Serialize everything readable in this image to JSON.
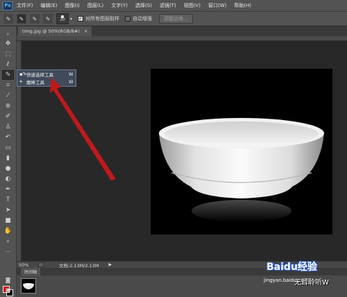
{
  "app": {
    "logo": "Ps"
  },
  "menu": [
    "文件(F)",
    "编辑(E)",
    "图像(I)",
    "图层(L)",
    "文字(Y)",
    "选择(S)",
    "滤镜(T)",
    "视图(V)",
    "窗口(W)",
    "帮助(H)"
  ],
  "options": {
    "brush_size": "30",
    "sample_all_label": "对所有图层取样",
    "auto_enhance_label": "自动增强",
    "refine_edge_label": "调整边缘..."
  },
  "document": {
    "tab_title": "timg.jpg @ 50%(RGB/8#)",
    "tab_close": "×"
  },
  "flyout": {
    "items": [
      {
        "label": "快速选择工具",
        "key": "W"
      },
      {
        "label": "魔棒工具",
        "key": "W"
      }
    ]
  },
  "status": {
    "zoom": "50%",
    "doc_info": "文档:2.13M/2.13M"
  },
  "timeline": {
    "tab_label": "时间轴"
  },
  "watermark": {
    "brand": "Baidu经验",
    "url": "jingyan.baidu.com",
    "author": "无耳聆听W"
  },
  "colors": {
    "foreground": "#d00000",
    "background": "#000000",
    "arrow": "#c0191c"
  }
}
